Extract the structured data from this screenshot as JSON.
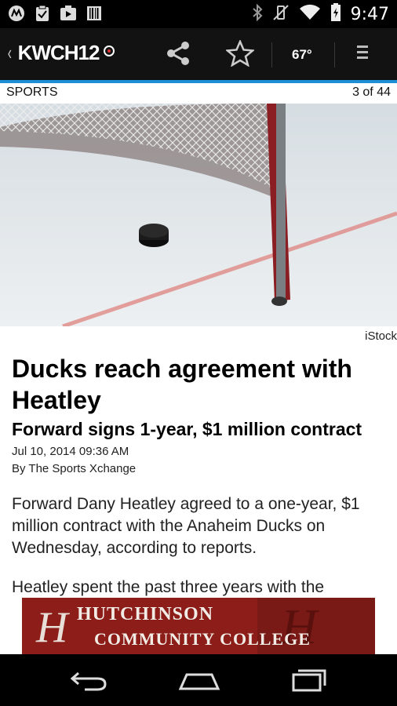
{
  "status_bar": {
    "time": "9:47"
  },
  "app_bar": {
    "back_glyph": "‹",
    "logo_text": "KWCH12",
    "temperature": "67°",
    "accent_color": "#1d8fd6"
  },
  "section": {
    "name": "SPORTS",
    "counter": "3 of 44"
  },
  "photo": {
    "credit": "iStock"
  },
  "article": {
    "headline": "Ducks reach agreement with Heatley",
    "subheadline": "Forward signs 1-year, $1 million contract",
    "date": "Jul 10, 2014 09:36 AM",
    "byline": "By The Sports Xchange",
    "paragraphs": [
      "Forward Dany Heatley agreed to a one-year, $1 million contract with the Anaheim Ducks on Wednesday, according to reports.",
      "Heatley spent the past three years with the"
    ]
  },
  "ad": {
    "line1": "HUTCHINSON",
    "line2": "COMMUNITY COLLEGE",
    "background_color": "#7a1a16"
  }
}
